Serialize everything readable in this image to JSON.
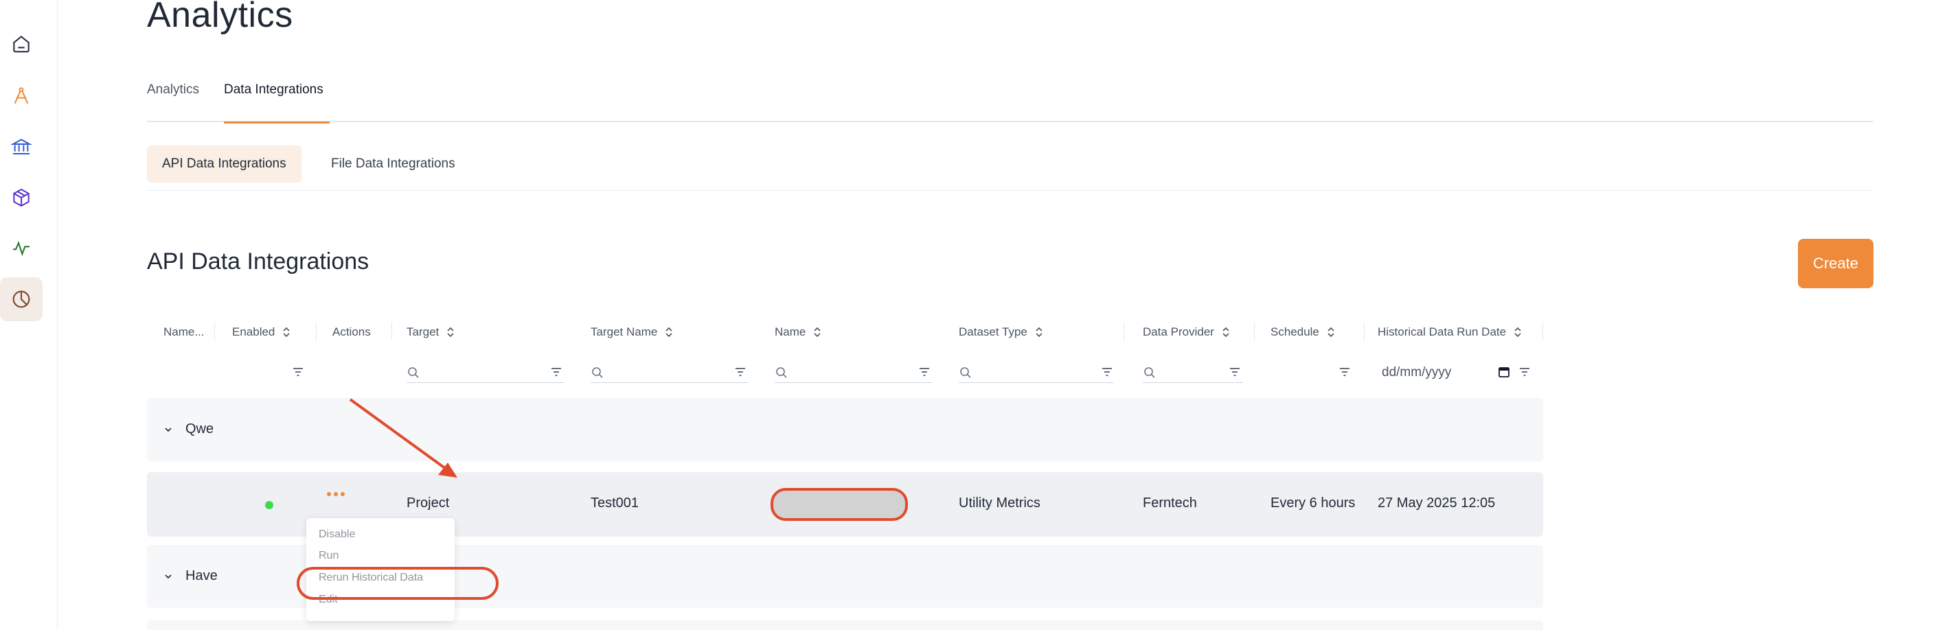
{
  "sidebar": {
    "items": [
      {
        "icon": "home-icon",
        "color": "#2b3245"
      },
      {
        "icon": "compass-icon",
        "color": "#ef8a3a"
      },
      {
        "icon": "bank-icon",
        "color": "#2f5bd3"
      },
      {
        "icon": "box-icon",
        "color": "#5b2fd3"
      },
      {
        "icon": "pulse-icon",
        "color": "#2f7d32"
      },
      {
        "icon": "pie-chart-icon",
        "color": "#7a4a2a",
        "active": true
      }
    ]
  },
  "page": {
    "title": "Analytics"
  },
  "tabs": {
    "analytics": "Analytics",
    "data_integrations": "Data Integrations",
    "active": "data_integrations"
  },
  "subtabs": {
    "api": "API Data Integrations",
    "file": "File Data Integrations",
    "active": "api"
  },
  "section": {
    "title": "API Data Integrations",
    "create_label": "Create"
  },
  "table": {
    "headers": {
      "name": "Name...",
      "enabled": "Enabled",
      "actions": "Actions",
      "target": "Target",
      "target_name": "Target Name",
      "name2": "Name",
      "dataset_type": "Dataset Type",
      "data_provider": "Data Provider",
      "schedule": "Schedule",
      "historical": "Historical Data Run Date"
    },
    "date_placeholder": "dd/mm/yyyy",
    "groups": [
      {
        "label": "Qwe"
      },
      {
        "label": "Have"
      }
    ],
    "row": {
      "enabled": true,
      "target": "Project",
      "target_name": "Test001",
      "dataset_type": "Utility Metrics",
      "data_provider": "Ferntech",
      "schedule": "Every 6 hours",
      "historical": "27 May 2025 12:05"
    }
  },
  "actions_menu": {
    "items": [
      "Disable",
      "Run",
      "Rerun Historical Data",
      "Edit"
    ],
    "highlighted": "Rerun Historical Data"
  },
  "colors": {
    "accent": "#ef8a3a",
    "annotation": "#e04b2f",
    "enabled_dot": "#3ddc4a"
  }
}
